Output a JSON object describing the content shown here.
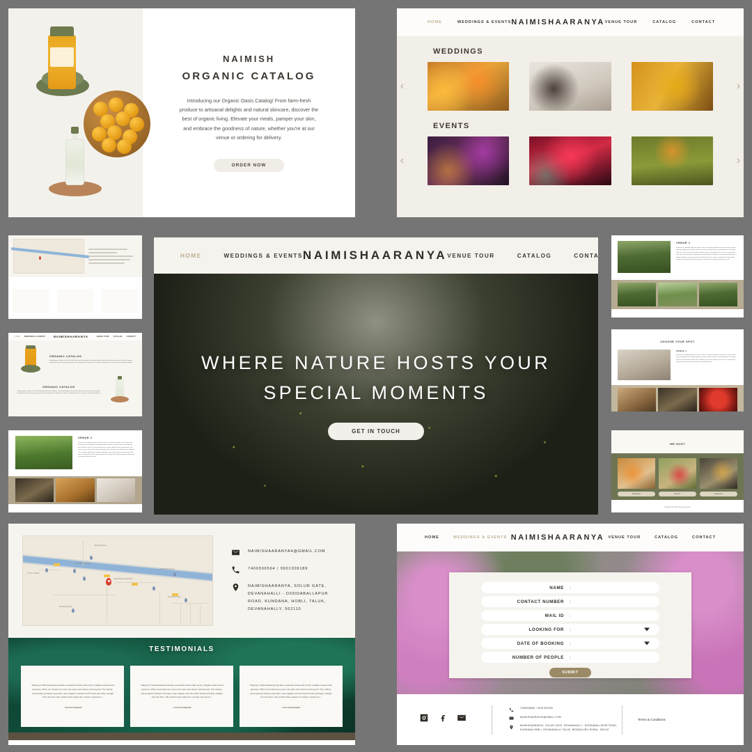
{
  "brand": "NAIMISHAARANYA",
  "nav": {
    "left": [
      "HOME",
      "WEDDINGS & EVENTS"
    ],
    "right": [
      "VENUE TOUR",
      "CATALOG",
      "CONTACT"
    ]
  },
  "catalog_panel": {
    "title_line1": "NAIMISH",
    "title_line2": "ORGANIC CATALOG",
    "body": "Introducing our Organic Oasis Catalog! From farm-fresh produce to artisanal delights and natural skincare, discover the best of organic living. Elevate your meals, pamper your skin, and embrace the goodness of nature, whether you're at our venue or ordering for delivery.",
    "cta": "ORDER NOW"
  },
  "weddings_events_panel": {
    "weddings_title": "WEDDINGS",
    "events_title": "EVENTS",
    "prev_arrow": "‹",
    "next_arrow": "›"
  },
  "hero_panel": {
    "heading_line1": "WHERE NATURE HOSTS YOUR",
    "heading_line2": "SPECIAL MOMENTS",
    "cta": "GET IN TOUCH"
  },
  "mini_venue1": {
    "title": "VENUE 1",
    "body": "Discover our captivating open-air venue, where a canopy of majestic coconut trees sets a unique stage, providing an enchanting ambiance perfect for grand events surrounded by over 200 green trees. For every setting, where nature embraces your every moment, the venue is a sanctuary of calm and colour where your celebrations unfold with grace. Whether it is an intimate gathering or a grand celebration, every corner invites warmth and joy. Our space is designed to let the natural beauty shine through while offering modern comfort and a seamless experience for all."
  },
  "mini_venue2": {
    "title": "VENUE 2"
  },
  "mini_spot": {
    "header": "CHOOSE YOUR SPOT",
    "title": "VENUE 1",
    "body": "Discover our captivating open-air venue, where a canopy of majestic coconut trees sets a unique stage, providing an enchanting ambiance perfect for grand events surrounded by over 200 green trees. For every setting, where nature embraces your every moment, the venue is a sanctuary of calm and colour where your celebrations unfold with grace."
  },
  "mini_host": {
    "header": "WE HOST",
    "buttons": [
      "Weddings",
      "Events",
      "Corporate"
    ],
    "footnote": "Choose your spot. Plan your event."
  },
  "mini_catalog": {
    "title1": "ORGANIC CATALOG",
    "title2": "ORGANIC CATALOG",
    "body": "Introducing our Organic Oasis Catalog! From farm-fresh produce to artisanal delights and natural skincare, discover the best of organic living. Elevate your meals, pamper your skin, and embrace the goodness of nature, whether you're at our venue or ordering for delivery."
  },
  "contact_panel": {
    "email": "NAIMISHAARANYA4@GMAIL.COM",
    "phone": "7406506564 / 9901309189",
    "address": "NAIMISHAARANYA, SOLUR GATE, DEVANAHALLI - DODDABALLAPUR ROAD, KUNDANA, HOBLI, TALUK, DEVANAHALLY, 562110",
    "testimonials_title": "TESTIMONIALS",
    "testimonials": [
      {
        "quote": "\"Staying in Naimishaaranya felt like a peaceful retreat with comfy cottages tucked amid greenery. When we hosted our event, the team went above and beyond. The setting, surrounded by flowers and stars, was magical. And the food? Fresh and tasty, straight from the farm. We couldn't have asked for a better experience.\"",
        "author": "- Anusha Kalapalli"
      },
      {
        "quote": "\"Staying in Naimishaaranya felt like a peaceful retreat with comfy cottages tucked amid greenery. When we hosted our event, the team went above and beyond. The setting, surrounded by flowers and stars, was magical. And the food? Fresh and tasty, straight from the farm. We couldn't have asked for a better experience.\"",
        "author": "- Anusha Kalapalli"
      },
      {
        "quote": "\"Staying in Naimishaaranya felt like a peaceful retreat with comfy cottages tucked amid greenery. When we hosted our event, the team went above and beyond. The setting, surrounded by flowers and stars, was magical. And the food? Fresh and tasty, straight from the farm. We couldn't have asked for a better experience.\"",
        "author": "- Anusha Kalapalli"
      }
    ]
  },
  "form_panel": {
    "fields": [
      {
        "label": "NAME",
        "value": "",
        "dropdown": false
      },
      {
        "label": "CONTACT NUMBER",
        "value": "",
        "dropdown": false
      },
      {
        "label": "MAIL ID",
        "value": "",
        "dropdown": false
      },
      {
        "label": "LOOKING FOR",
        "value": "",
        "dropdown": true
      },
      {
        "label": "DATE OF BOOKING",
        "value": "",
        "dropdown": true
      },
      {
        "label": "NUMBER OF PEOPLE",
        "value": "",
        "dropdown": false
      }
    ],
    "colon": ":",
    "submit": "SUBMIT",
    "footer": {
      "phone": "7406506564 / 9901309189",
      "email": "NAIMISHAARANYA@GMAIL.COM",
      "address": "NAIMISHAARANYA, SOLUR GATE, DEVANAHALLI - DODDABALLAPUR ROAD, KUNDANA HOBLI, DEVANAHALLI TALUK, BENGALURU RURAL, 562110",
      "terms": "Terms & Conditions"
    }
  },
  "colors": {
    "background": "#757575",
    "cream": "#f2efe8",
    "accent_gold": "#bdae92",
    "dark_text": "#2f2b26",
    "olive": "#6e7553",
    "submit_gold": "#9b8a66"
  }
}
